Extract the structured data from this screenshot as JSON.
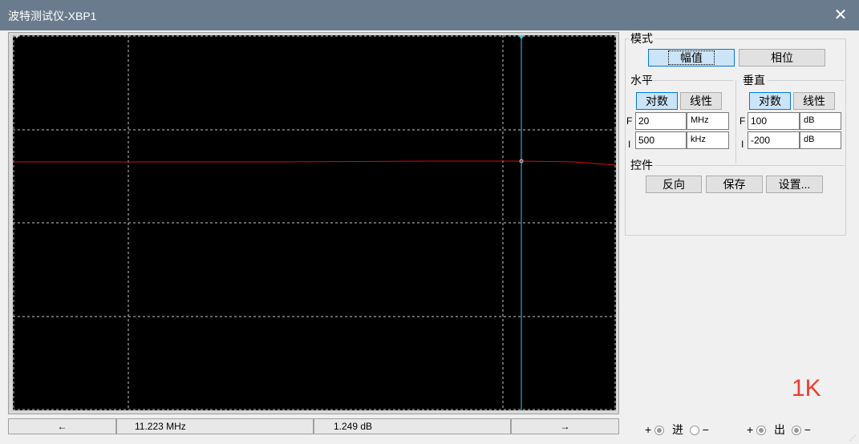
{
  "window": {
    "title": "波特测试仪-XBP1",
    "close_glyph": "✕"
  },
  "status": {
    "left_arrow": "←",
    "frequency": "11.223 MHz",
    "magnitude": "1.249 dB",
    "right_arrow": "→"
  },
  "mode": {
    "legend": "模式",
    "magnitude_label": "幅值",
    "phase_label": "相位"
  },
  "horizontal": {
    "legend": "水平",
    "log_label": "对数",
    "linear_label": "线性",
    "f_label": "F",
    "f_value": "20",
    "f_unit": "MHz",
    "i_label": "I",
    "i_value": "500",
    "i_unit": "kHz"
  },
  "vertical": {
    "legend": "垂直",
    "log_label": "对数",
    "linear_label": "线性",
    "f_label": "F",
    "f_value": "100",
    "f_unit": "dB",
    "i_label": "I",
    "i_value": "-200",
    "i_unit": "dB"
  },
  "controls": {
    "legend": "控件",
    "reverse_label": "反向",
    "save_label": "保存",
    "settings_label": "设置..."
  },
  "overlay_text": "1K",
  "terminals": {
    "plus": "+",
    "minus": "−",
    "in_label": "进",
    "out_label": "出"
  },
  "colors": {
    "trace": "#d01010",
    "cursor": "#40c8e8",
    "grid": "#c8c8c8",
    "plot_bg": "#000000",
    "overlay": "#f23c2c"
  }
}
